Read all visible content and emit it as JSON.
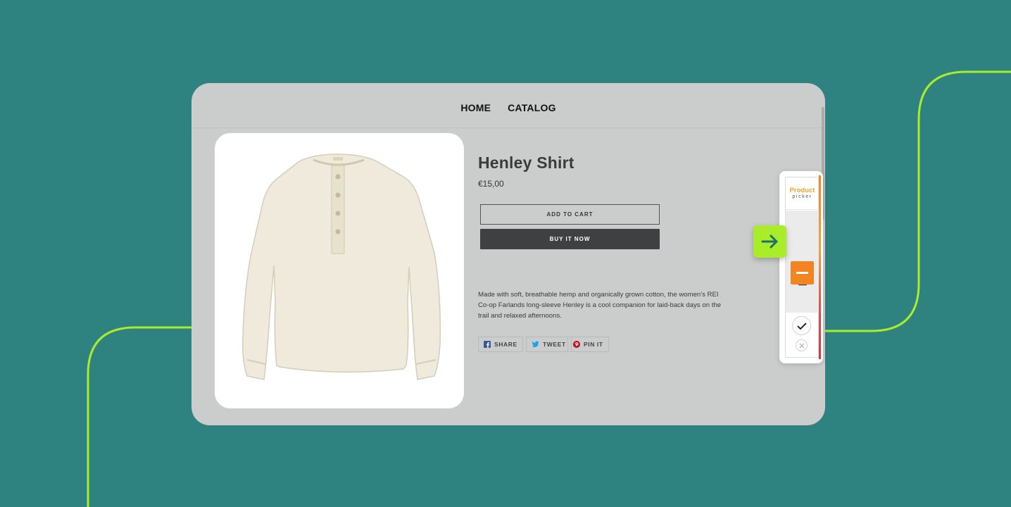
{
  "nav": {
    "items": [
      "HOME",
      "CATALOG"
    ]
  },
  "product": {
    "title": "Henley Shirt",
    "price": "€15,00",
    "add_to_cart_label": "ADD TO CART",
    "buy_now_label": "BUY IT NOW",
    "description": "Made with soft, breathable hemp and organically grown cotton, the women's REI Co-op Farlands long-sleeve Henley is a cool companion for laid-back days on the trail and relaxed afternoons.",
    "image_icon": "henley-shirt-image"
  },
  "share": {
    "facebook_label": "SHARE",
    "twitter_label": "TWEET",
    "pinterest_label": "PIN IT"
  },
  "picker": {
    "logo_top": "Product",
    "logo_bottom": "picker",
    "count": "1",
    "icons": [
      "arrow-right-icon",
      "minus-icon",
      "check-icon",
      "close-icon"
    ]
  },
  "colors": {
    "background": "#2e8280",
    "accent_lime": "#a9ec2a",
    "accent_orange": "#f28421",
    "buy_button": "#3f4041"
  }
}
